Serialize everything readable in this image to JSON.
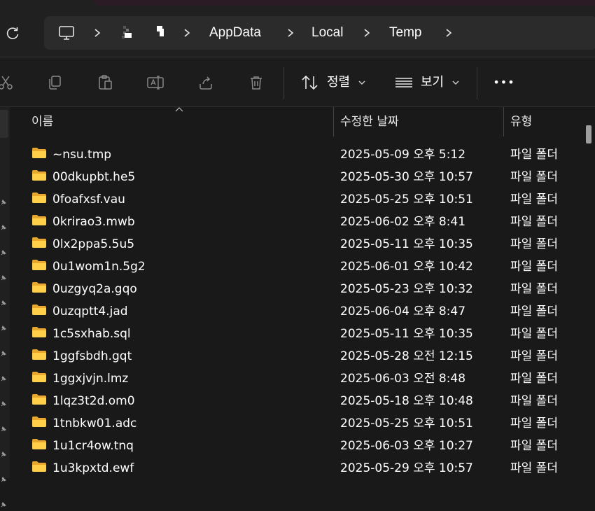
{
  "address_bar": {
    "crumbs": [
      "AppData",
      "Local",
      "Temp"
    ]
  },
  "toolbar": {
    "sort_label": "정렬",
    "view_label": "보기",
    "more_label": "•••"
  },
  "columns": {
    "name": "이름",
    "date": "수정한 날짜",
    "type": "유형"
  },
  "files": [
    {
      "name": "~nsu.tmp",
      "date": "2025-05-09 오후 5:12",
      "type": "파일 폴더"
    },
    {
      "name": "00dkupbt.he5",
      "date": "2025-05-30 오후 10:57",
      "type": "파일 폴더"
    },
    {
      "name": "0foafxsf.vau",
      "date": "2025-05-25 오후 10:51",
      "type": "파일 폴더"
    },
    {
      "name": "0krirao3.mwb",
      "date": "2025-06-02 오후 8:41",
      "type": "파일 폴더"
    },
    {
      "name": "0lx2ppa5.5u5",
      "date": "2025-05-11 오후 10:35",
      "type": "파일 폴더"
    },
    {
      "name": "0u1wom1n.5g2",
      "date": "2025-06-01 오후 10:42",
      "type": "파일 폴더"
    },
    {
      "name": "0uzgyq2a.gqo",
      "date": "2025-05-23 오후 10:32",
      "type": "파일 폴더"
    },
    {
      "name": "0uzqptt4.jad",
      "date": "2025-06-04 오후 8:47",
      "type": "파일 폴더"
    },
    {
      "name": "1c5sxhab.sql",
      "date": "2025-05-11 오후 10:35",
      "type": "파일 폴더"
    },
    {
      "name": "1ggfsbdh.gqt",
      "date": "2025-05-28 오전 12:15",
      "type": "파일 폴더"
    },
    {
      "name": "1ggxjvjn.lmz",
      "date": "2025-06-03 오전 8:48",
      "type": "파일 폴더"
    },
    {
      "name": "1lqz3t2d.om0",
      "date": "2025-05-18 오후 10:48",
      "type": "파일 폴더"
    },
    {
      "name": "1tnbkw01.adc",
      "date": "2025-05-25 오후 10:51",
      "type": "파일 폴더"
    },
    {
      "name": "1u1cr4ow.tnq",
      "date": "2025-06-03 오후 10:27",
      "type": "파일 폴더"
    },
    {
      "name": "1u3kpxtd.ewf",
      "date": "2025-05-29 오후 10:57",
      "type": "파일 폴더"
    }
  ]
}
